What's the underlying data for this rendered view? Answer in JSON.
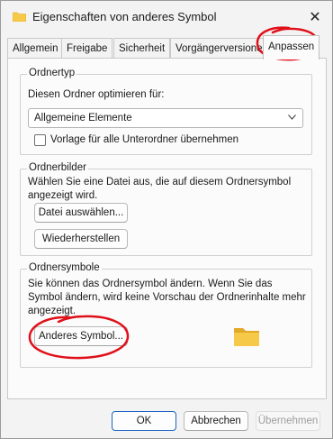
{
  "window": {
    "title": "Eigenschaften von anderes Symbol",
    "close_glyph": "✕",
    "icon": "folder-icon"
  },
  "tabs": [
    {
      "label": "Allgemein"
    },
    {
      "label": "Freigabe"
    },
    {
      "label": "Sicherheit"
    },
    {
      "label": "Vorgängerversionen"
    },
    {
      "label": "Anpassen",
      "active": true
    }
  ],
  "ordnertyp": {
    "group_label": "Ordnertyp",
    "optimize_label": "Diesen Ordner optimieren für:",
    "select_value": "Allgemeine Elemente",
    "template_checkbox_label": "Vorlage für alle Unterordner übernehmen",
    "template_checked": false
  },
  "ordnerbilder": {
    "group_label": "Ordnerbilder",
    "description": "Wählen Sie eine Datei aus, die auf diesem Ordnersymbol angezeigt wird.",
    "choose_file_button": "Datei auswählen...",
    "restore_button": "Wiederherstellen"
  },
  "ordnersymbole": {
    "group_label": "Ordnersymbole",
    "description": "Sie können das Ordnersymbol ändern. Wenn Sie das Symbol ändern, wird keine Vorschau der Ordnerinhalte mehr angezeigt.",
    "change_icon_button": "Anderes Symbol...",
    "preview_icon": "folder-icon"
  },
  "footer": {
    "ok_button": "OK",
    "cancel_button": "Abbrechen",
    "apply_button": "Übernehmen",
    "apply_disabled": true
  },
  "colors": {
    "folder": "#f7c948",
    "folder_dark": "#e3a928",
    "annotation": "#e0101a",
    "primary_border": "#1f63c5"
  }
}
